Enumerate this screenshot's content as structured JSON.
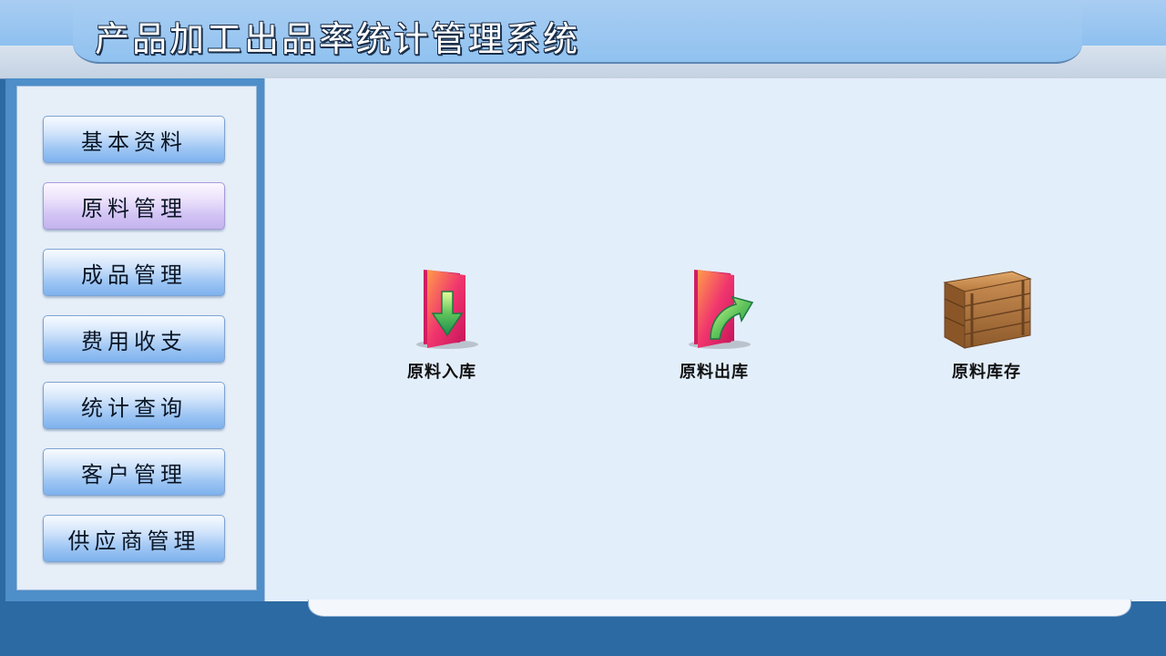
{
  "header": {
    "title": "产品加工出品率统计管理系统"
  },
  "sidebar": {
    "items": [
      {
        "label": "基本资料"
      },
      {
        "label": "原料管理",
        "active": true
      },
      {
        "label": "成品管理"
      },
      {
        "label": "费用收支"
      },
      {
        "label": "统计查询"
      },
      {
        "label": "客户管理"
      },
      {
        "label": "供应商管理"
      }
    ]
  },
  "main": {
    "tiles": [
      {
        "label": "原料入库",
        "icon": "folder-download-icon"
      },
      {
        "label": "原料出库",
        "icon": "folder-export-icon"
      },
      {
        "label": "原料库存",
        "icon": "crate-icon"
      }
    ]
  },
  "colors": {
    "accent": "#8ec0ef",
    "frame": "#2b6aa3",
    "content_bg": "#e3eefb",
    "active_button": "#c4b4ef"
  }
}
